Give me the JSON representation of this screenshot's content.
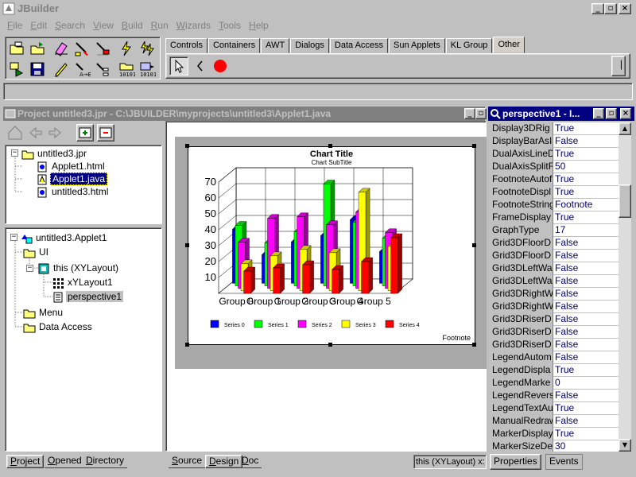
{
  "app": {
    "title": "JBuilder",
    "min": "_",
    "max": "▫",
    "close": "×"
  },
  "menu": [
    {
      "u": "F",
      "rest": "ile"
    },
    {
      "u": "E",
      "rest": "dit"
    },
    {
      "u": "S",
      "rest": "earch"
    },
    {
      "u": "V",
      "rest": "iew"
    },
    {
      "u": "B",
      "rest": "uild"
    },
    {
      "u": "R",
      "rest": "un"
    },
    {
      "u": "W",
      "rest": "izards"
    },
    {
      "u": "T",
      "rest": "ools"
    },
    {
      "u": "H",
      "rest": "elp"
    }
  ],
  "palette": {
    "tabs": [
      "Controls",
      "Containers",
      "AWT",
      "Dialogs",
      "Data Access",
      "Sun Applets",
      "KL Group",
      "Other"
    ],
    "active_tab": "Other"
  },
  "project_window": {
    "title": "Project untitled3.jpr - C:\\JBUILDER\\myprojects\\untitled3\\Applet1.java",
    "tree_files": {
      "root": "untitled3.jpr",
      "items": [
        "Applet1.html",
        "Applet1.java",
        "untitled3.html"
      ],
      "selected": "Applet1.java"
    },
    "tree_structure": {
      "root": "untitled3.Applet1",
      "ui": "UI",
      "this": "this (XYLayout)",
      "layout": "xYLayout1",
      "component": "perspective1",
      "menu": "Menu",
      "data_access": "Data Access"
    },
    "bottom_tabs": [
      {
        "u": "P",
        "rest": "roject"
      },
      {
        "u": "O",
        "rest": "pened"
      },
      {
        "u": "D",
        "rest": "irectory"
      }
    ]
  },
  "designer": {
    "tabs": [
      {
        "u": "S",
        "rest": "ource"
      },
      {
        "u": "D",
        "rest": "esign"
      },
      {
        "u": "D",
        "rest": "oc"
      }
    ],
    "status": "this (XYLayout) x:"
  },
  "chart_data": {
    "type": "bar",
    "title": "Chart Title",
    "subtitle": "Chart SubTitle",
    "footnote": "Footnote",
    "categories": [
      "Group 0",
      "Group 1",
      "Group 2",
      "Group 3",
      "Group 4",
      "Group 5"
    ],
    "yticks": [
      10,
      20,
      30,
      40,
      50,
      60,
      70
    ],
    "ylim": [
      0,
      70
    ],
    "series": [
      {
        "name": "Series 0",
        "color": "#0000ff",
        "values": [
          34,
          18,
          26,
          30,
          40,
          20
        ]
      },
      {
        "name": "Series 1",
        "color": "#00ff00",
        "values": [
          38,
          27,
          34,
          64,
          40,
          30
        ]
      },
      {
        "name": "Series 2",
        "color": "#ff00ff",
        "values": [
          29,
          44,
          45,
          40,
          48,
          35
        ]
      },
      {
        "name": "Series 3",
        "color": "#ffff00",
        "values": [
          17,
          22,
          26,
          24,
          62,
          28
        ]
      },
      {
        "name": "Series 4",
        "color": "#ff0000",
        "values": [
          14,
          16,
          18,
          15,
          20,
          35
        ]
      }
    ],
    "legend": "bottom"
  },
  "inspector": {
    "title": "perspective1 - I...",
    "properties": [
      {
        "name": "Display3DRig",
        "value": "True"
      },
      {
        "name": "DisplayBarAsI",
        "value": "False"
      },
      {
        "name": "DualAxisLineD",
        "value": "True"
      },
      {
        "name": "DualAxisSplitF",
        "value": "50"
      },
      {
        "name": "FootnoteAutof",
        "value": "True"
      },
      {
        "name": "FootnoteDispl",
        "value": "True"
      },
      {
        "name": "FootnoteString",
        "value": "Footnote"
      },
      {
        "name": "FrameDisplay",
        "value": "True"
      },
      {
        "name": "GraphType",
        "value": "17"
      },
      {
        "name": "Grid3DFloorD",
        "value": "False"
      },
      {
        "name": "Grid3DFloorD",
        "value": "False"
      },
      {
        "name": "Grid3DLeftWa",
        "value": "False"
      },
      {
        "name": "Grid3DLeftWa",
        "value": "False"
      },
      {
        "name": "Grid3DRightW",
        "value": "False"
      },
      {
        "name": "Grid3DRightW",
        "value": "False"
      },
      {
        "name": "Grid3DRiserD",
        "value": "False"
      },
      {
        "name": "Grid3DRiserD",
        "value": "False"
      },
      {
        "name": "Grid3DRiserD",
        "value": "False"
      },
      {
        "name": "LegendAutom",
        "value": "False"
      },
      {
        "name": "LegendDispla",
        "value": "True"
      },
      {
        "name": "LegendMarke",
        "value": "0"
      },
      {
        "name": "LegendRevers",
        "value": "False"
      },
      {
        "name": "LegendTextAu",
        "value": "True"
      },
      {
        "name": "ManualRedraw",
        "value": "False"
      },
      {
        "name": "MarkerDisplay",
        "value": "True"
      },
      {
        "name": "MarkerSizeDe",
        "value": "30"
      }
    ],
    "tabs": [
      "Properties",
      "Events"
    ]
  }
}
